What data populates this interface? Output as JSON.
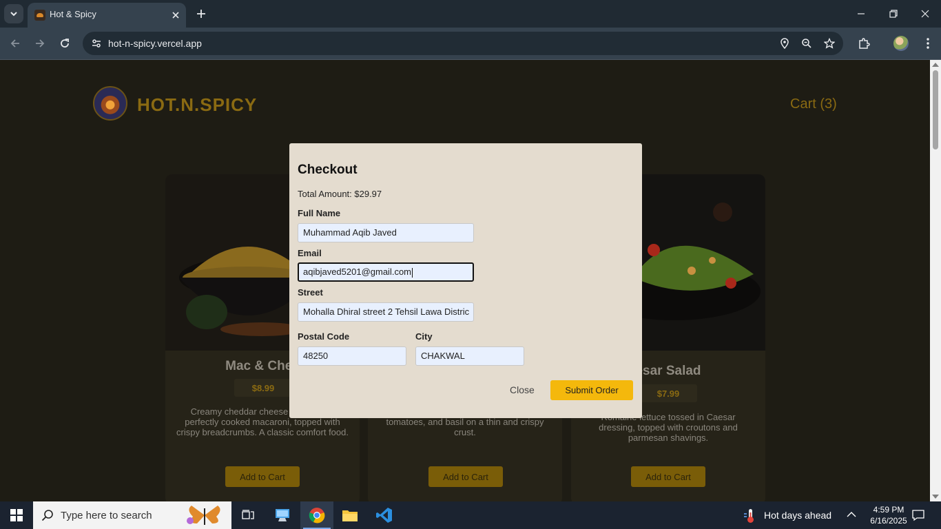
{
  "browser": {
    "tab_title": "Hot & Spicy",
    "url": "hot-n-spicy.vercel.app"
  },
  "header": {
    "brand": "HOT.N.SPICY",
    "cart": "Cart (3)"
  },
  "products": [
    {
      "title": "Mac & Chee",
      "price": "$8.99",
      "description": "Creamy cheddar cheese sauce over perfectly cooked macaroni, topped with crispy breadcrumbs. A classic comfort food.",
      "button": "Add to Cart"
    },
    {
      "title": "",
      "price": "",
      "description": "A classic pizza with fresh mozzarella, tomatoes, and basil on a thin and crispy crust.",
      "button": "Add to Cart"
    },
    {
      "title": "esar Salad",
      "price": "$7.99",
      "description": "Romaine lettuce tossed in Caesar dressing, topped with croutons and parmesan shavings.",
      "button": "Add to Cart"
    }
  ],
  "checkout": {
    "title": "Checkout",
    "total": "Total Amount: $29.97",
    "full_name_label": "Full Name",
    "full_name_value": "Muhammad Aqib Javed",
    "email_label": "Email",
    "email_value": "aqibjaved5201@gmail.com",
    "street_label": "Street",
    "street_value": "Mohalla Dhiral street 2 Tehsil Lawa Distric",
    "postal_label": "Postal Code",
    "postal_value": "48250",
    "city_label": "City",
    "city_value": "CHAKWAL",
    "close": "Close",
    "submit": "Submit Order"
  },
  "taskbar": {
    "search_placeholder": "Type here to search",
    "weather": "Hot days ahead",
    "time": "4:59 PM",
    "date": "6/16/2025"
  }
}
